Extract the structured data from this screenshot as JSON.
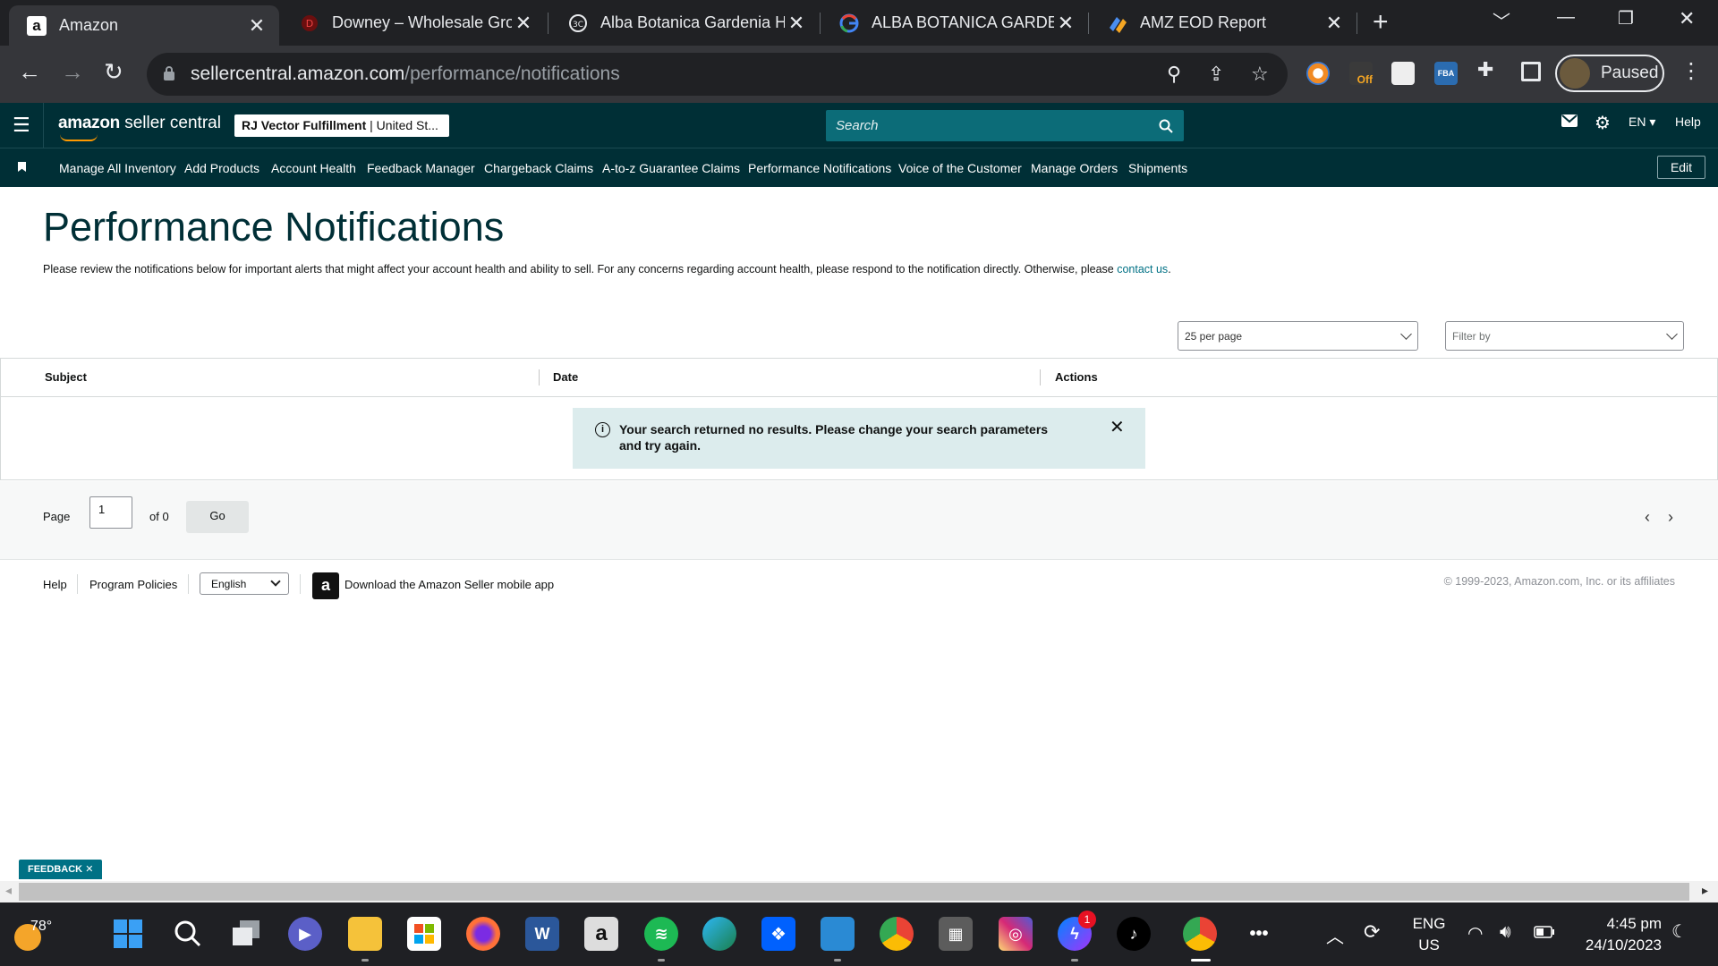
{
  "browser": {
    "tabs": [
      {
        "title": "Amazon",
        "icon": "amazon-favicon-icon",
        "active": true
      },
      {
        "title": "Downey – Wholesale Gro",
        "icon": "downey-favicon-icon"
      },
      {
        "title": "Alba Botanica Gardenia H",
        "icon": "page-favicon-icon"
      },
      {
        "title": "ALBA BOTANICA GARDEN",
        "icon": "google-favicon-icon"
      },
      {
        "title": "AMZ EOD Report",
        "icon": "report-favicon-icon"
      }
    ],
    "url_host": "sellercentral.amazon.com",
    "url_path": "/performance/notifications",
    "profile_label": "Paused"
  },
  "header": {
    "logo_text_bold": "amazon",
    "logo_text": " seller central",
    "account_bold": "RJ Vector Fulfillment",
    "account_sep": " | ",
    "account_region": "United St...",
    "search_placeholder": "Search",
    "language": "EN",
    "help": "Help"
  },
  "nav": {
    "items": [
      "Manage All Inventory",
      "Add Products",
      "Account Health",
      "Feedback Manager",
      "Chargeback Claims",
      "A-to-z Guarantee Claims",
      "Performance Notifications",
      "Voice of the Customer",
      "Manage Orders",
      "Shipments"
    ],
    "edit_label": "Edit"
  },
  "main": {
    "title": "Performance Notifications",
    "intro_text": "Please review the notifications below for important alerts that might affect your account health and ability to sell. For any concerns regarding account health, please respond to the notification directly. Otherwise, please ",
    "intro_link": "contact us",
    "intro_end": ".",
    "per_page": "25 per page",
    "filter_placeholder": "Filter by",
    "columns": [
      "Subject",
      "Date",
      "Actions"
    ],
    "alert_message": "Your search returned no results. Please change your search parameters and try again."
  },
  "pager": {
    "page_label": "Page",
    "page_value": "1",
    "of_label": "of 0",
    "go_label": "Go"
  },
  "footer": {
    "help": "Help",
    "policies": "Program Policies",
    "language": "English",
    "app_link": "Download the Amazon Seller mobile app",
    "copyright": "© 1999-2023, Amazon.com, Inc. or its affiliates"
  },
  "feedback_label": "FEEDBACK",
  "taskbar": {
    "weather_temp": "78°",
    "lang_line1": "ENG",
    "lang_line2": "US",
    "time": "4:45 pm",
    "date": "24/10/2023",
    "messenger_badge": "1"
  }
}
